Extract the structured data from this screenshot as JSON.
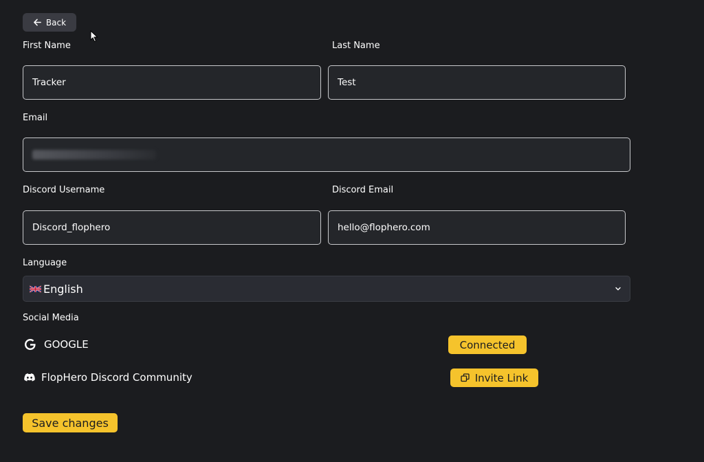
{
  "back": {
    "label": "Back"
  },
  "form": {
    "first_name": {
      "label": "First Name",
      "value": "Tracker"
    },
    "last_name": {
      "label": "Last Name",
      "value": "Test"
    },
    "email": {
      "label": "Email",
      "value": ""
    },
    "discord_username": {
      "label": "Discord Username",
      "value": "Discord_flophero"
    },
    "discord_email": {
      "label": "Discord Email",
      "value": "hello@flophero.com"
    },
    "language": {
      "label": "Language",
      "value": "English",
      "flag": "uk-flag-icon"
    }
  },
  "social": {
    "heading": "Social Media",
    "google": {
      "name": "GOOGLE",
      "status": "Connected",
      "icon": "google-icon"
    },
    "discord": {
      "name": "FlopHero Discord Community",
      "action": "Invite Link",
      "icon": "discord-icon"
    }
  },
  "actions": {
    "save_label": "Save changes"
  },
  "colors": {
    "background": "#1b1c1f",
    "accent": "#f5c32c",
    "field_bg": "#24262a",
    "field_border": "#c8c9cc"
  }
}
